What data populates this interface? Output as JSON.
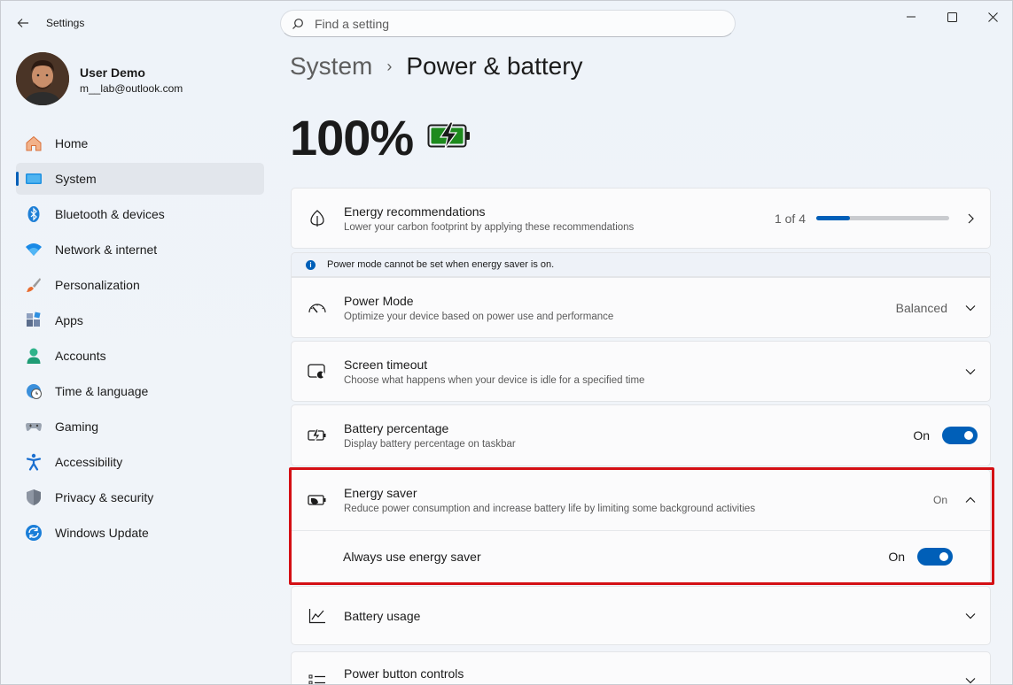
{
  "window": {
    "app_title": "Settings"
  },
  "search": {
    "placeholder": "Find a setting"
  },
  "user": {
    "name": "User Demo",
    "email": "m__lab@outlook.com"
  },
  "sidebar": {
    "items": [
      {
        "label": "Home",
        "icon": "home-icon",
        "active": false
      },
      {
        "label": "System",
        "icon": "system-icon",
        "active": true
      },
      {
        "label": "Bluetooth & devices",
        "icon": "bluetooth-icon",
        "active": false
      },
      {
        "label": "Network & internet",
        "icon": "wifi-icon",
        "active": false
      },
      {
        "label": "Personalization",
        "icon": "brush-icon",
        "active": false
      },
      {
        "label": "Apps",
        "icon": "apps-icon",
        "active": false
      },
      {
        "label": "Accounts",
        "icon": "person-icon",
        "active": false
      },
      {
        "label": "Time & language",
        "icon": "clock-globe-icon",
        "active": false
      },
      {
        "label": "Gaming",
        "icon": "gamepad-icon",
        "active": false
      },
      {
        "label": "Accessibility",
        "icon": "accessibility-icon",
        "active": false
      },
      {
        "label": "Privacy & security",
        "icon": "shield-icon",
        "active": false
      },
      {
        "label": "Windows Update",
        "icon": "update-icon",
        "active": false
      }
    ]
  },
  "breadcrumb": {
    "parent": "System",
    "separator": "›",
    "current": "Power & battery"
  },
  "battery": {
    "percent": "100%",
    "charging": true
  },
  "energy_recommendations": {
    "title": "Energy recommendations",
    "subtitle": "Lower your carbon footprint by applying these recommendations",
    "count": "1 of 4",
    "progress": 0.25
  },
  "info_bar": {
    "message": "Power mode cannot be set when energy saver is on."
  },
  "power_mode": {
    "title": "Power Mode",
    "subtitle": "Optimize your device based on power use and performance",
    "value": "Balanced"
  },
  "screen_timeout": {
    "title": "Screen timeout",
    "subtitle": "Choose what happens when your device is idle for a specified time"
  },
  "battery_percentage": {
    "title": "Battery percentage",
    "subtitle": "Display battery percentage on taskbar",
    "state": "On"
  },
  "energy_saver": {
    "title": "Energy saver",
    "subtitle": "Reduce power consumption and increase battery life by limiting some background activities",
    "state": "On",
    "always_use_label": "Always use energy saver",
    "always_use_state": "On"
  },
  "battery_usage": {
    "title": "Battery usage"
  },
  "power_button_controls": {
    "title": "Power button controls"
  },
  "colors": {
    "accent": "#005fb8",
    "highlight_border": "#d40f14",
    "battery_fill": "#1d8a1d"
  }
}
